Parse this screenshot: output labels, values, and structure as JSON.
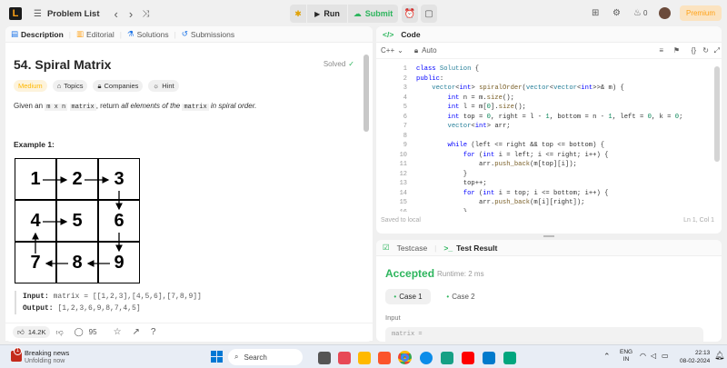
{
  "nav": {
    "problem_list": "Problem List",
    "run": "Run",
    "submit": "Submit",
    "streak": "0",
    "premium": "Premium"
  },
  "left_tabs": {
    "description": "Description",
    "editorial": "Editorial",
    "solutions": "Solutions",
    "submissions": "Submissions"
  },
  "problem": {
    "title": "54. Spiral Matrix",
    "status": "Solved",
    "difficulty": "Medium",
    "topics": "Topics",
    "companies": "Companies",
    "hint": "Hint",
    "desc_1": "Given an ",
    "desc_code1": "m x n",
    "desc_code2": "matrix",
    "desc_2": ", return ",
    "desc_3": "all elements of the ",
    "desc_code3": "matrix",
    "desc_4": " in spiral order.",
    "example_title": "Example 1:",
    "grid": [
      "1",
      "2",
      "3",
      "4",
      "5",
      "6",
      "7",
      "8",
      "9"
    ],
    "input_label": "Input:",
    "input_value": "matrix = [[1,2,3],[4,5,6],[7,8,9]]",
    "output_label": "Output:",
    "output_value": "[1,2,3,6,9,8,7,4,5]"
  },
  "bottom": {
    "likes": "14.2K",
    "comments": "95"
  },
  "code": {
    "tab": "Code",
    "language": "C++",
    "auto": "Auto",
    "saved": "Saved to local",
    "cursor": "Ln 1, Col 1",
    "line_numbers": [
      "1",
      "2",
      "3",
      "4",
      "5",
      "6",
      "7",
      "8",
      "9",
      "10",
      "11",
      "12",
      "13",
      "14",
      "15",
      "16"
    ]
  },
  "test": {
    "testcase_tab": "Testcase",
    "result_tab": "Test Result",
    "accepted": "Accepted",
    "runtime": "Runtime: 2 ms",
    "case1": "Case 1",
    "case2": "Case 2",
    "input_label": "Input",
    "input_field": "matrix ="
  },
  "taskbar": {
    "news_title": "Breaking news",
    "news_sub": "Unfolding now",
    "search": "Search",
    "lang1": "ENG",
    "lang2": "IN",
    "time": "22:13",
    "date": "08-02-2024",
    "badge": "1"
  },
  "colors": {
    "accent_green": "#2db55d",
    "medium": "#ffb800",
    "premium": "#ffa116",
    "link": "#1a73e8"
  }
}
